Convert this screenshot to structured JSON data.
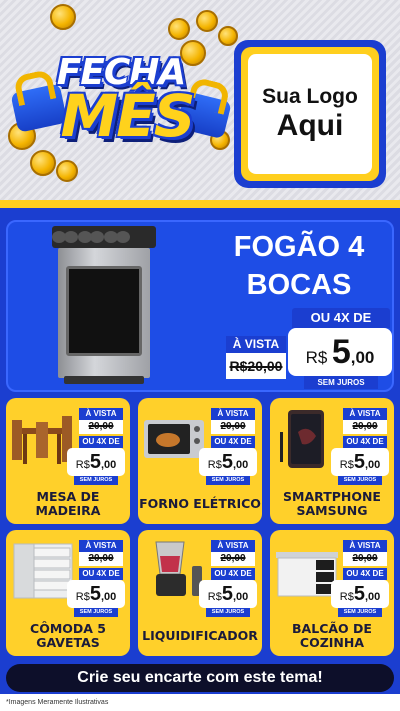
{
  "header": {
    "title_line1": "FECHA",
    "title_line2": "MÊS",
    "logo_line1": "Sua Logo",
    "logo_line2": "Aqui"
  },
  "featured": {
    "name_line1": "FOGÃO 4",
    "name_line2": "BOCAS",
    "installment_label": "OU 4X DE",
    "cash_label": "À VISTA",
    "old_currency": "R$",
    "old_value": "20,00",
    "currency": "R$",
    "price_int": "5",
    "price_cents": ",00",
    "no_interest": "SEM JUROS"
  },
  "products": [
    {
      "name_line1": "MESA DE",
      "name_line2": "MADEIRA",
      "cash_label": "À VISTA",
      "old_value": "20,00",
      "installment_label": "OU 4X DE",
      "currency": "R$",
      "price_int": "5",
      "price_cents": ",00",
      "no_interest": "SEM JUROS"
    },
    {
      "name_line1": "FORNO ELÉTRICO",
      "name_line2": "",
      "cash_label": "À VISTA",
      "old_value": "20,00",
      "installment_label": "OU 4X DE",
      "currency": "R$",
      "price_int": "5",
      "price_cents": ",00",
      "no_interest": "SEM JUROS"
    },
    {
      "name_line1": "SMARTPHONE",
      "name_line2": "SAMSUNG",
      "cash_label": "À VISTA",
      "old_value": "20,00",
      "installment_label": "OU 4X DE",
      "currency": "R$",
      "price_int": "5",
      "price_cents": ",00",
      "no_interest": "SEM JUROS"
    },
    {
      "name_line1": "CÔMODA 5",
      "name_line2": "GAVETAS",
      "cash_label": "À VISTA",
      "old_value": "20,00",
      "installment_label": "OU 4X DE",
      "currency": "R$",
      "price_int": "5",
      "price_cents": ",00",
      "no_interest": "SEM JUROS"
    },
    {
      "name_line1": "LIQUIDIFICADOR",
      "name_line2": "",
      "cash_label": "À VISTA",
      "old_value": "20,00",
      "installment_label": "OU 4X DE",
      "currency": "R$",
      "price_int": "5",
      "price_cents": ",00",
      "no_interest": "SEM JUROS"
    },
    {
      "name_line1": "BALCÃO DE",
      "name_line2": "COZINHA",
      "cash_label": "À VISTA",
      "old_value": "20,00",
      "installment_label": "OU 4X DE",
      "currency": "R$",
      "price_int": "5",
      "price_cents": ",00",
      "no_interest": "SEM JUROS"
    }
  ],
  "cta": "Crie seu encarte com este tema!",
  "disclaimer": "*Imagens Meramente Ilustrativas",
  "colors": {
    "brand_blue": "#1b3ed0",
    "brand_yellow": "#ffd02a",
    "card_text": "#1b1b3a"
  },
  "icons": [
    "coin-icon",
    "padlock-icon"
  ]
}
